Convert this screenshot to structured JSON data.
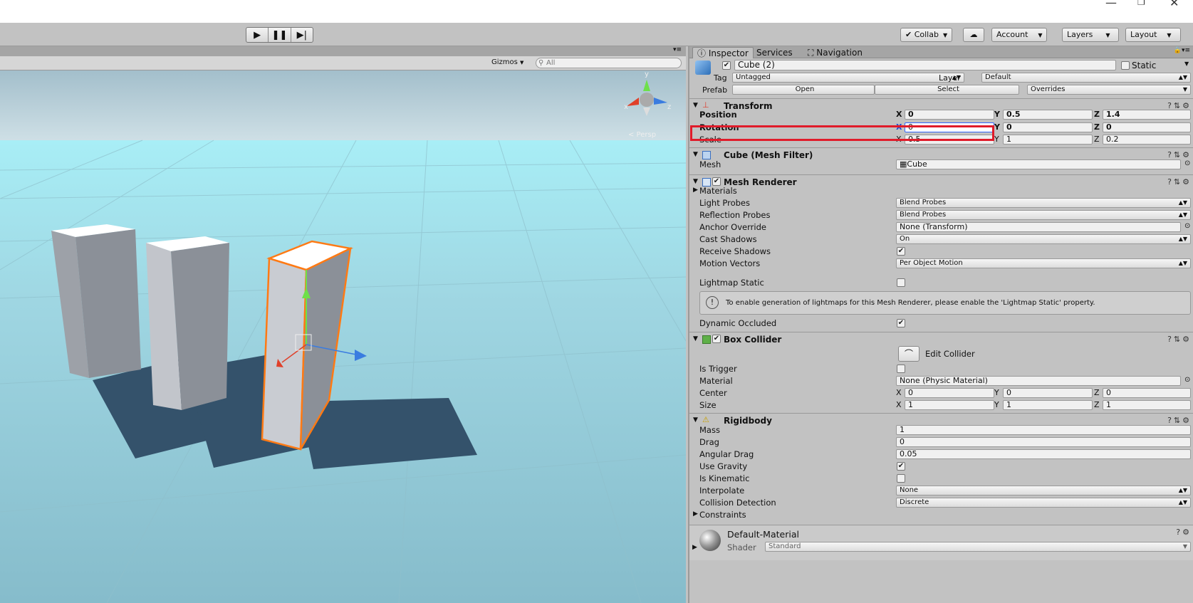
{
  "toolbar": {
    "collab": "Collab",
    "account": "Account",
    "layers": "Layers",
    "layout": "Layout"
  },
  "scene": {
    "gizmos": "Gizmos",
    "search_placeholder": "All",
    "persp": "< Persp",
    "axes": {
      "y": "y",
      "x": "x",
      "z": "z"
    }
  },
  "inspector": {
    "tabs": [
      "Inspector",
      "Services",
      "Navigation"
    ],
    "object_name": "Cube (2)",
    "static_label": "Static",
    "tag_label": "Tag",
    "tag_value": "Untagged",
    "layer_label": "Layer",
    "layer_value": "Default",
    "prefab_label": "Prefab",
    "prefab_open": "Open",
    "prefab_select": "Select",
    "prefab_overrides": "Overrides",
    "transform": {
      "title": "Transform",
      "position": {
        "label": "Position",
        "x": "0",
        "y": "0.5",
        "z": "1.4"
      },
      "rotation": {
        "label": "Rotation",
        "x": "0",
        "y": "0",
        "z": "0"
      },
      "scale": {
        "label": "Scale",
        "x": "0.5",
        "y": "1",
        "z": "0.2"
      }
    },
    "mesh_filter": {
      "title": "Cube (Mesh Filter)",
      "mesh_label": "Mesh",
      "mesh_value": "Cube"
    },
    "mesh_renderer": {
      "title": "Mesh Renderer",
      "materials": "Materials",
      "light_probes_label": "Light Probes",
      "light_probes": "Blend Probes",
      "reflection_probes_label": "Reflection Probes",
      "reflection_probes": "Blend Probes",
      "anchor_label": "Anchor Override",
      "anchor": "None (Transform)",
      "cast_label": "Cast Shadows",
      "cast": "On",
      "receive_label": "Receive Shadows",
      "motion_label": "Motion Vectors",
      "motion": "Per Object Motion",
      "lightmap_label": "Lightmap Static",
      "info": "To enable generation of lightmaps for this Mesh Renderer, please enable the 'Lightmap Static' property.",
      "dynamic_label": "Dynamic Occluded"
    },
    "box_collider": {
      "title": "Box Collider",
      "edit": "Edit Collider",
      "trigger_label": "Is Trigger",
      "material_label": "Material",
      "material": "None (Physic Material)",
      "center_label": "Center",
      "center": {
        "x": "0",
        "y": "0",
        "z": "0"
      },
      "size_label": "Size",
      "size": {
        "x": "1",
        "y": "1",
        "z": "1"
      }
    },
    "rigidbody": {
      "title": "Rigidbody",
      "mass_label": "Mass",
      "mass": "1",
      "drag_label": "Drag",
      "drag": "0",
      "angular_label": "Angular Drag",
      "angular": "0.05",
      "gravity_label": "Use Gravity",
      "kinematic_label": "Is Kinematic",
      "interp_label": "Interpolate",
      "interp": "None",
      "collision_label": "Collision Detection",
      "collision": "Discrete",
      "constraints": "Constraints"
    },
    "material": {
      "name": "Default-Material",
      "shader_label": "Shader",
      "shader": "Standard"
    }
  },
  "axis_labels": {
    "x": "X",
    "y": "Y",
    "z": "Z"
  }
}
